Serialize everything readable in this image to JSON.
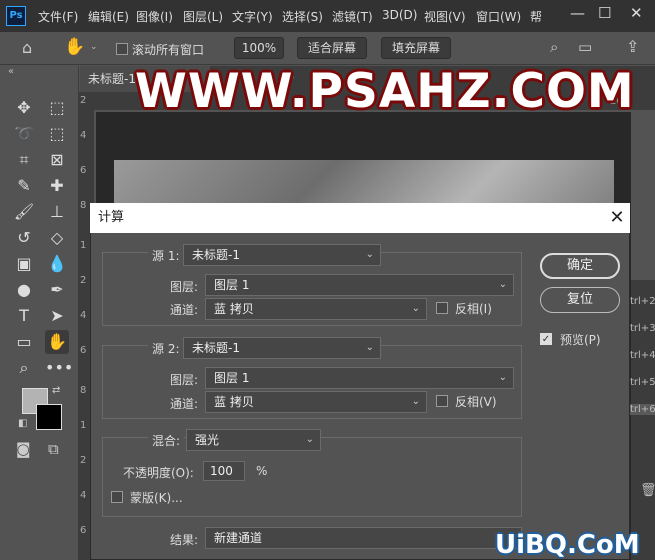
{
  "menubar": {
    "logo": "Ps",
    "items": [
      "文件(F)",
      "编辑(E)",
      "图像(I)",
      "图层(L)",
      "文字(Y)",
      "选择(S)",
      "滤镜(T)",
      "3D(D)",
      "视图(V)",
      "窗口(W)",
      "帮"
    ],
    "min": "—",
    "max": "☐",
    "close": "✕"
  },
  "options": {
    "scroll_all": "滚动所有窗口",
    "zoom": "100%",
    "fit_screen": "适合屏幕",
    "fill_screen": "填充屏幕"
  },
  "tabs": {
    "tab1": "未标题-1",
    "tab2": "7",
    "tab3": "*"
  },
  "ruler": {
    "top_right": "26",
    "left_marks": [
      "2",
      "4",
      "6",
      "8",
      "1",
      "2",
      "4",
      "6",
      "8",
      "1",
      "2",
      "4",
      "6"
    ]
  },
  "right_panel": [
    "trl+2",
    "trl+3",
    "trl+4",
    "trl+5",
    "trl+6"
  ],
  "watermark": "WWW.PSAHZ.COM",
  "watermark2": "UiBQ.CoM",
  "dialog": {
    "title": "计算",
    "source1": {
      "label": "源 1:",
      "value": "未标题-1",
      "layer_label": "图层:",
      "layer": "图层 1",
      "channel_label": "通道:",
      "channel": "蓝 拷贝",
      "invert": "反相(I)"
    },
    "source2": {
      "label": "源 2:",
      "value": "未标题-1",
      "layer_label": "图层:",
      "layer": "图层 1",
      "channel_label": "通道:",
      "channel": "蓝 拷贝",
      "invert": "反相(V)"
    },
    "blend": {
      "label": "混合:",
      "value": "强光",
      "opacity_label": "不透明度(O):",
      "opacity": "100",
      "percent": "%",
      "mask": "蒙版(K)..."
    },
    "result": {
      "label": "结果:",
      "value": "新建通道"
    },
    "ok": "确定",
    "reset": "复位",
    "preview": "预览(P)"
  },
  "colors": {
    "accent": "#31a8ff",
    "watermark_outline": "#7a0a0a"
  }
}
